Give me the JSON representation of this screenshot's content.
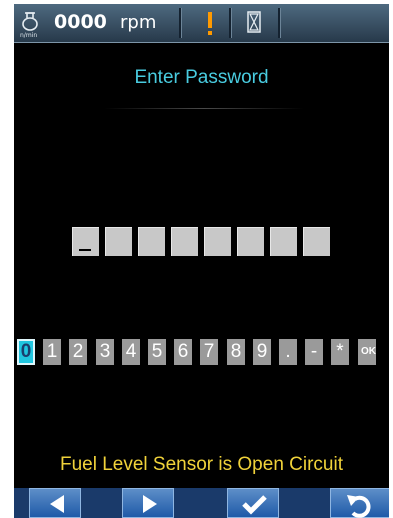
{
  "status_bar": {
    "engine_icon": "engine-speed-icon",
    "engine_unit": "n/min",
    "rpm_value": "0000",
    "rpm_unit": "rpm",
    "warning_icon": "warning-icon",
    "hourglass_icon": "hourglass-icon"
  },
  "title": "Enter Password",
  "password": {
    "box_count": 8,
    "cursor_position": 1
  },
  "keypad": {
    "selected": "0",
    "keys": [
      "0",
      "1",
      "2",
      "3",
      "4",
      "5",
      "6",
      "7",
      "8",
      "9",
      ".",
      "-",
      "*",
      "OK"
    ]
  },
  "status_message": "Fuel Level Sensor is Open Circuit",
  "nav": {
    "left_icon": "arrow-left-icon",
    "right_icon": "arrow-right-icon",
    "confirm_icon": "checkmark-icon",
    "back_icon": "undo-icon"
  },
  "colors": {
    "title": "#49cce0",
    "status": "#f0d23a",
    "selected_key": "#20c6e0",
    "key": "#9a9a9a",
    "warning": "#ff9a00"
  }
}
